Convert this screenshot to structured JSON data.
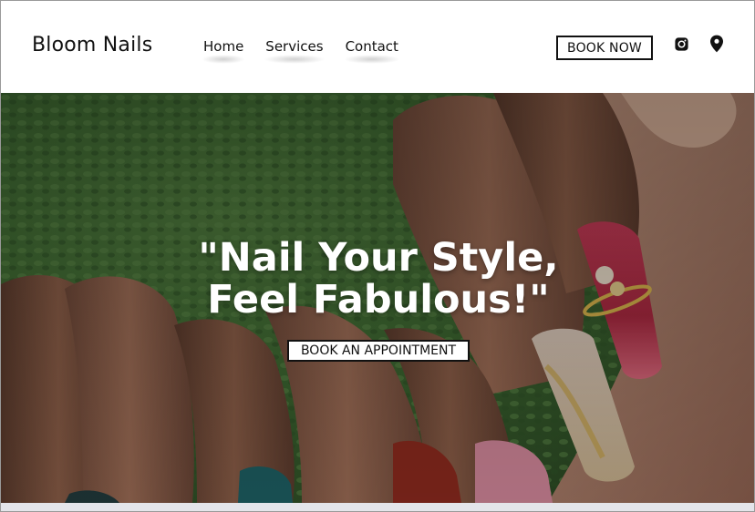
{
  "header": {
    "brand": "Bloom Nails",
    "nav": [
      {
        "label": "Home"
      },
      {
        "label": "Services"
      },
      {
        "label": "Contact"
      }
    ],
    "book_now_label": "BOOK NOW",
    "icons": [
      "instagram-icon",
      "location-pin-icon"
    ]
  },
  "hero": {
    "title_line1": "\"Nail Your Style,",
    "title_line2": "Feel Fabulous!\"",
    "cta_label": "BOOK AN APPOINTMENT"
  },
  "colors": {
    "text": "#111111",
    "background": "#ffffff",
    "footer_strip": "#e4e5ea",
    "hero_text": "#ffffff"
  }
}
